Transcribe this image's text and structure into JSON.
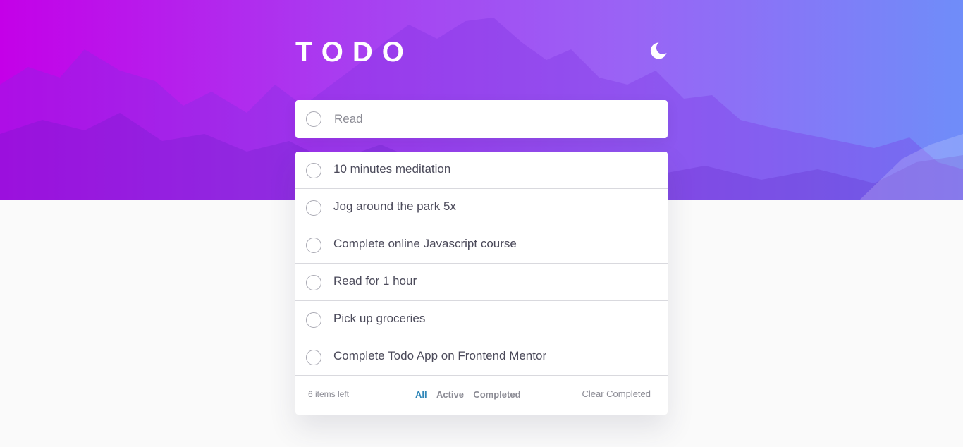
{
  "header": {
    "title": "TODO",
    "theme_icon": "moon-icon"
  },
  "new_todo": {
    "placeholder": "Read",
    "value": ""
  },
  "todos": [
    {
      "text": "10 minutes meditation",
      "completed": false
    },
    {
      "text": "Jog around the park 5x",
      "completed": false
    },
    {
      "text": "Complete online Javascript course",
      "completed": false
    },
    {
      "text": "Read for 1 hour",
      "completed": false
    },
    {
      "text": "Pick up groceries",
      "completed": false
    },
    {
      "text": "Complete Todo App on Frontend Mentor",
      "completed": false
    }
  ],
  "footer": {
    "items_left": "6 items left",
    "filters": [
      {
        "label": "All",
        "active": true
      },
      {
        "label": "Active",
        "active": false
      },
      {
        "label": "Completed",
        "active": false
      }
    ],
    "clear_label": "Clear Completed"
  },
  "colors": {
    "gradient_start": "#c400e8",
    "gradient_end": "#6f8df9",
    "active_filter": "#2f86b8",
    "page_background": "#fafafa"
  }
}
